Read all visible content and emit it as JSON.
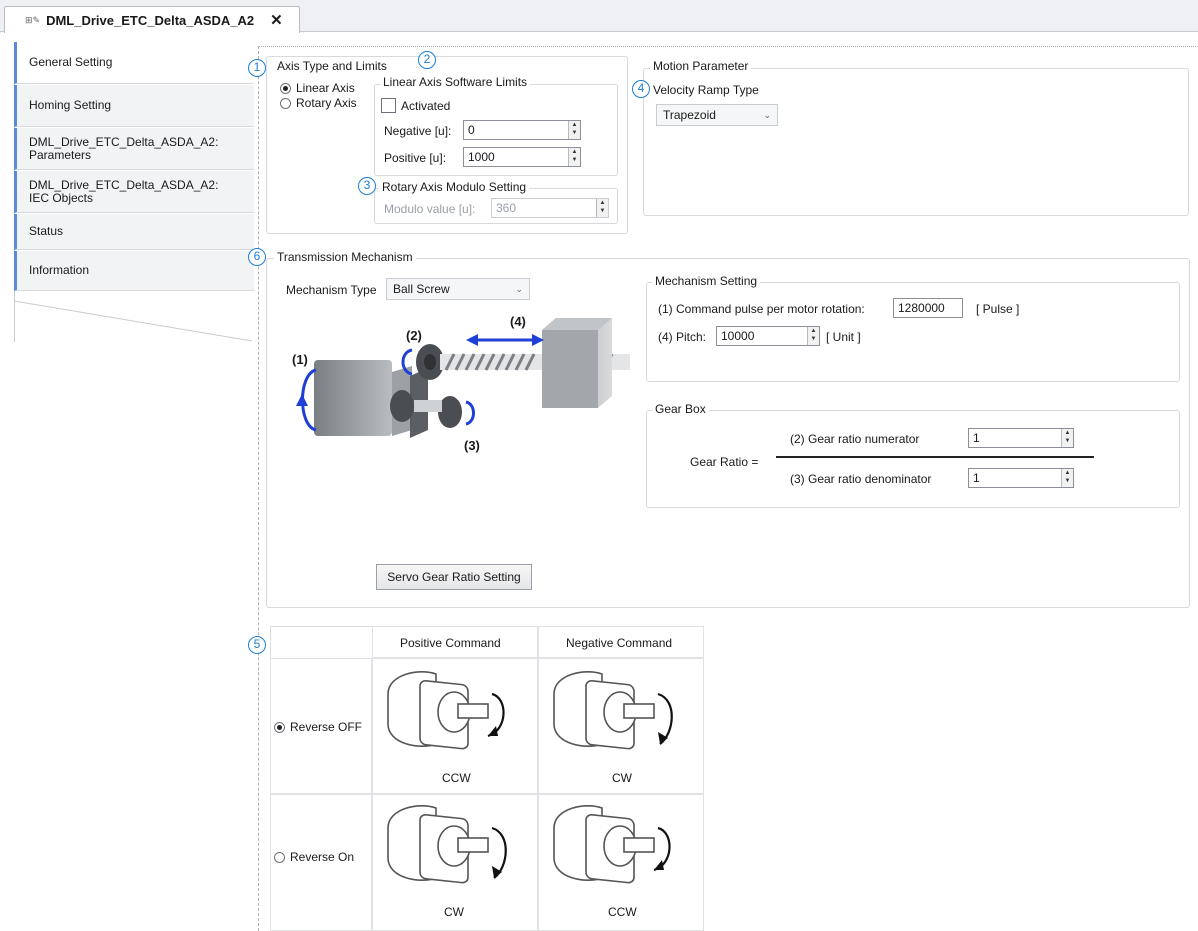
{
  "tab": {
    "title": "DML_Drive_ETC_Delta_ASDA_A2",
    "close": "✕",
    "icons": "⊞✎"
  },
  "nav": {
    "items": [
      {
        "label": "General Setting"
      },
      {
        "label": "Homing Setting"
      },
      {
        "label": "DML_Drive_ETC_Delta_ASDA_A2: Parameters"
      },
      {
        "label": "DML_Drive_ETC_Delta_ASDA_A2: IEC Objects"
      },
      {
        "label": "Status"
      },
      {
        "label": "Information"
      }
    ]
  },
  "badges": {
    "b1": "1",
    "b2": "2",
    "b3": "3",
    "b4": "4",
    "b5": "5",
    "b6": "6"
  },
  "axis": {
    "title": "Axis Type and Limits",
    "linear": "Linear Axis",
    "rotary": "Rotary Axis",
    "selected": "Linear Axis"
  },
  "linear_limits": {
    "title": "Linear Axis Software Limits",
    "activated": "Activated",
    "negative_label": "Negative [u]:",
    "negative_value": "0",
    "positive_label": "Positive [u]:",
    "positive_value": "1000"
  },
  "modulo": {
    "title": "Rotary Axis Modulo Setting",
    "label": "Modulo value [u]:",
    "value": "360"
  },
  "motion": {
    "title": "Motion Parameter",
    "ramp_label": "Velocity Ramp Type",
    "ramp_value": "Trapezoid"
  },
  "transmission": {
    "title": "Transmission Mechanism",
    "type_label": "Mechanism Type",
    "type_value": "Ball Screw",
    "diagram_labels": {
      "l1": "(1)",
      "l2": "(2)",
      "l3": "(3)",
      "l4": "(4)"
    },
    "servo_button": "Servo Gear Ratio Setting"
  },
  "mechanism": {
    "title": "Mechanism Setting",
    "pulse_label": "(1) Command pulse per motor rotation:",
    "pulse_value": "1280000",
    "pulse_unit": "[ Pulse ]",
    "pitch_label": "(4) Pitch:",
    "pitch_value": "10000",
    "pitch_unit": "[ Unit ]"
  },
  "gearbox": {
    "title": "Gear Box",
    "ratio_label": "Gear Ratio =",
    "num_label": "(2) Gear ratio numerator",
    "num_value": "1",
    "den_label": "(3) Gear ratio denominator",
    "den_value": "1"
  },
  "rotation": {
    "col_pos": "Positive Command",
    "col_neg": "Negative Command",
    "rev_off": "Reverse OFF",
    "rev_on": "Reverse On",
    "selected": "Reverse OFF",
    "r1c1": "CCW",
    "r1c2": "CW",
    "r2c1": "CW",
    "r2c2": "CCW"
  },
  "colors": {
    "accent": "#1a7fd6",
    "nav_accent": "#5b8ad8",
    "arrow_blue": "#1f3fd6"
  }
}
